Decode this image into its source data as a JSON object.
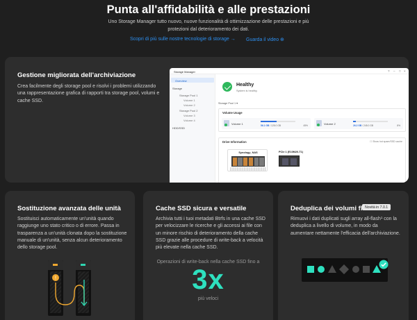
{
  "hero": {
    "title": "Punta all'affidabilità e alle prestazioni",
    "subtitle": "Uno Storage Manager tutto nuovo, nuove funzionalità di ottimizzazione delle prestazioni e più protezioni dal deterioramento dei dati.",
    "link_tech": "Scopri di più sulle nostre tecnologie di storage →",
    "link_video": "Guarda il video ⊕"
  },
  "storage_card": {
    "title": "Gestione migliorata dell'archiviazione",
    "description": "Crea facilmente degli storage pool e risolvi i problemi utilizzando una rappresentazione grafica di rapporti tra storage pool, volumi e cache SSD."
  },
  "window": {
    "title": "Storage Manager",
    "sidebar": {
      "overview": "Overview",
      "storage": "Storage",
      "pool1": "Storage Pool 1",
      "volume1": "Volume 1",
      "volume2": "Volume 2",
      "pool2": "Storage Pool 2",
      "volume3": "Volume 3",
      "volume4": "Volume 4",
      "hdd": "HDD/SSD"
    },
    "health": {
      "status": "Healthy",
      "detail": "System is healthy."
    },
    "pool_selector": "Storage Pool 1 ▾",
    "volume_usage": {
      "header": "Volume Usage",
      "volumes": [
        {
          "name": "Volume 1",
          "used": "56.1 GB",
          "total": "125.0 GB",
          "percent": "45%",
          "fill": 45
        },
        {
          "name": "Volume 2",
          "used": "26.2 GB",
          "total": "245.0 GB",
          "percent": "8%",
          "fill": 8
        }
      ]
    },
    "drive_info": {
      "header": "Drive Information",
      "checkbox_label": "Show hot spare/SSD cache",
      "nas_label": "Synology_NAS",
      "pcie_label": "PCIe 1 (E10M20-T1)"
    }
  },
  "replace_card": {
    "title": "Sostituzione avanzata delle unità",
    "description": "Sostituisci automaticamente un'unità quando raggiunge uno stato critico o di errore. Passa in trasparenza a un'unità clonata dopo la sostituzione manuale di un'unità, senza alcun deterioramento dello storage pool."
  },
  "cache_card": {
    "title": "Cache SSD sicura e versatile",
    "description": "Archivia tutti i tuoi metadati Btrfs in una cache SSD per velocizzare le ricerche e gli accessi ai file con un minore rischio di deterioramento della cache SSD grazie alle procedure di write-back a velocità più elevate nella cache SSD.",
    "speed_caption": "Operazioni di write-back nella cache SSD fino a",
    "speed_value": "3x",
    "speed_unit": "più veloci"
  },
  "dedup_card": {
    "title": "Deduplica dei volumi flash",
    "badge": "Novità in 7.0.1",
    "description": "Rimuovi i dati duplicati sugli array all-flash¹ con la deduplica a livello di volume, in modo da aumentare nettamente l'efficacia dell'archiviazione."
  },
  "colors": {
    "accent_teal": "#2ee0bf",
    "link_blue": "#2d8ff0",
    "healthy_green": "#2eb85c",
    "warning_orange": "#f0a830"
  }
}
